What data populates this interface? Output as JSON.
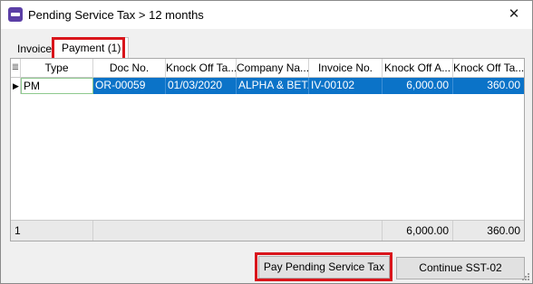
{
  "window": {
    "title": "Pending Service Tax > 12 months",
    "close_glyph": "✕",
    "app_icon": "app-logo-icon"
  },
  "tabs": [
    {
      "label": "Invoice",
      "active": false
    },
    {
      "label": "Payment (1)",
      "active": true
    }
  ],
  "grid": {
    "columns": [
      "Type",
      "Doc No.",
      "Knock Off Ta...",
      "Company Na...",
      "Invoice No.",
      "Knock Off A...",
      "Knock Off Ta..."
    ],
    "corner_glyph": "≣",
    "row_indicator": "▶",
    "rows": [
      {
        "type": "PM",
        "doc_no": "OR-00059",
        "knock_off_date": "01/03/2020",
        "company": "ALPHA & BET...",
        "invoice_no": "IV-00102",
        "knock_off_amount": "6,000.00",
        "knock_off_tax": "360.00"
      }
    ],
    "footer": {
      "count": "1",
      "total_amount": "6,000.00",
      "total_tax": "360.00"
    }
  },
  "buttons": {
    "pay": "Pay Pending Service Tax",
    "continue": "Continue SST-02"
  },
  "colors": {
    "selection": "#0b73c8",
    "highlight_box": "#d9151b",
    "app_icon": "#5b3fa6"
  }
}
